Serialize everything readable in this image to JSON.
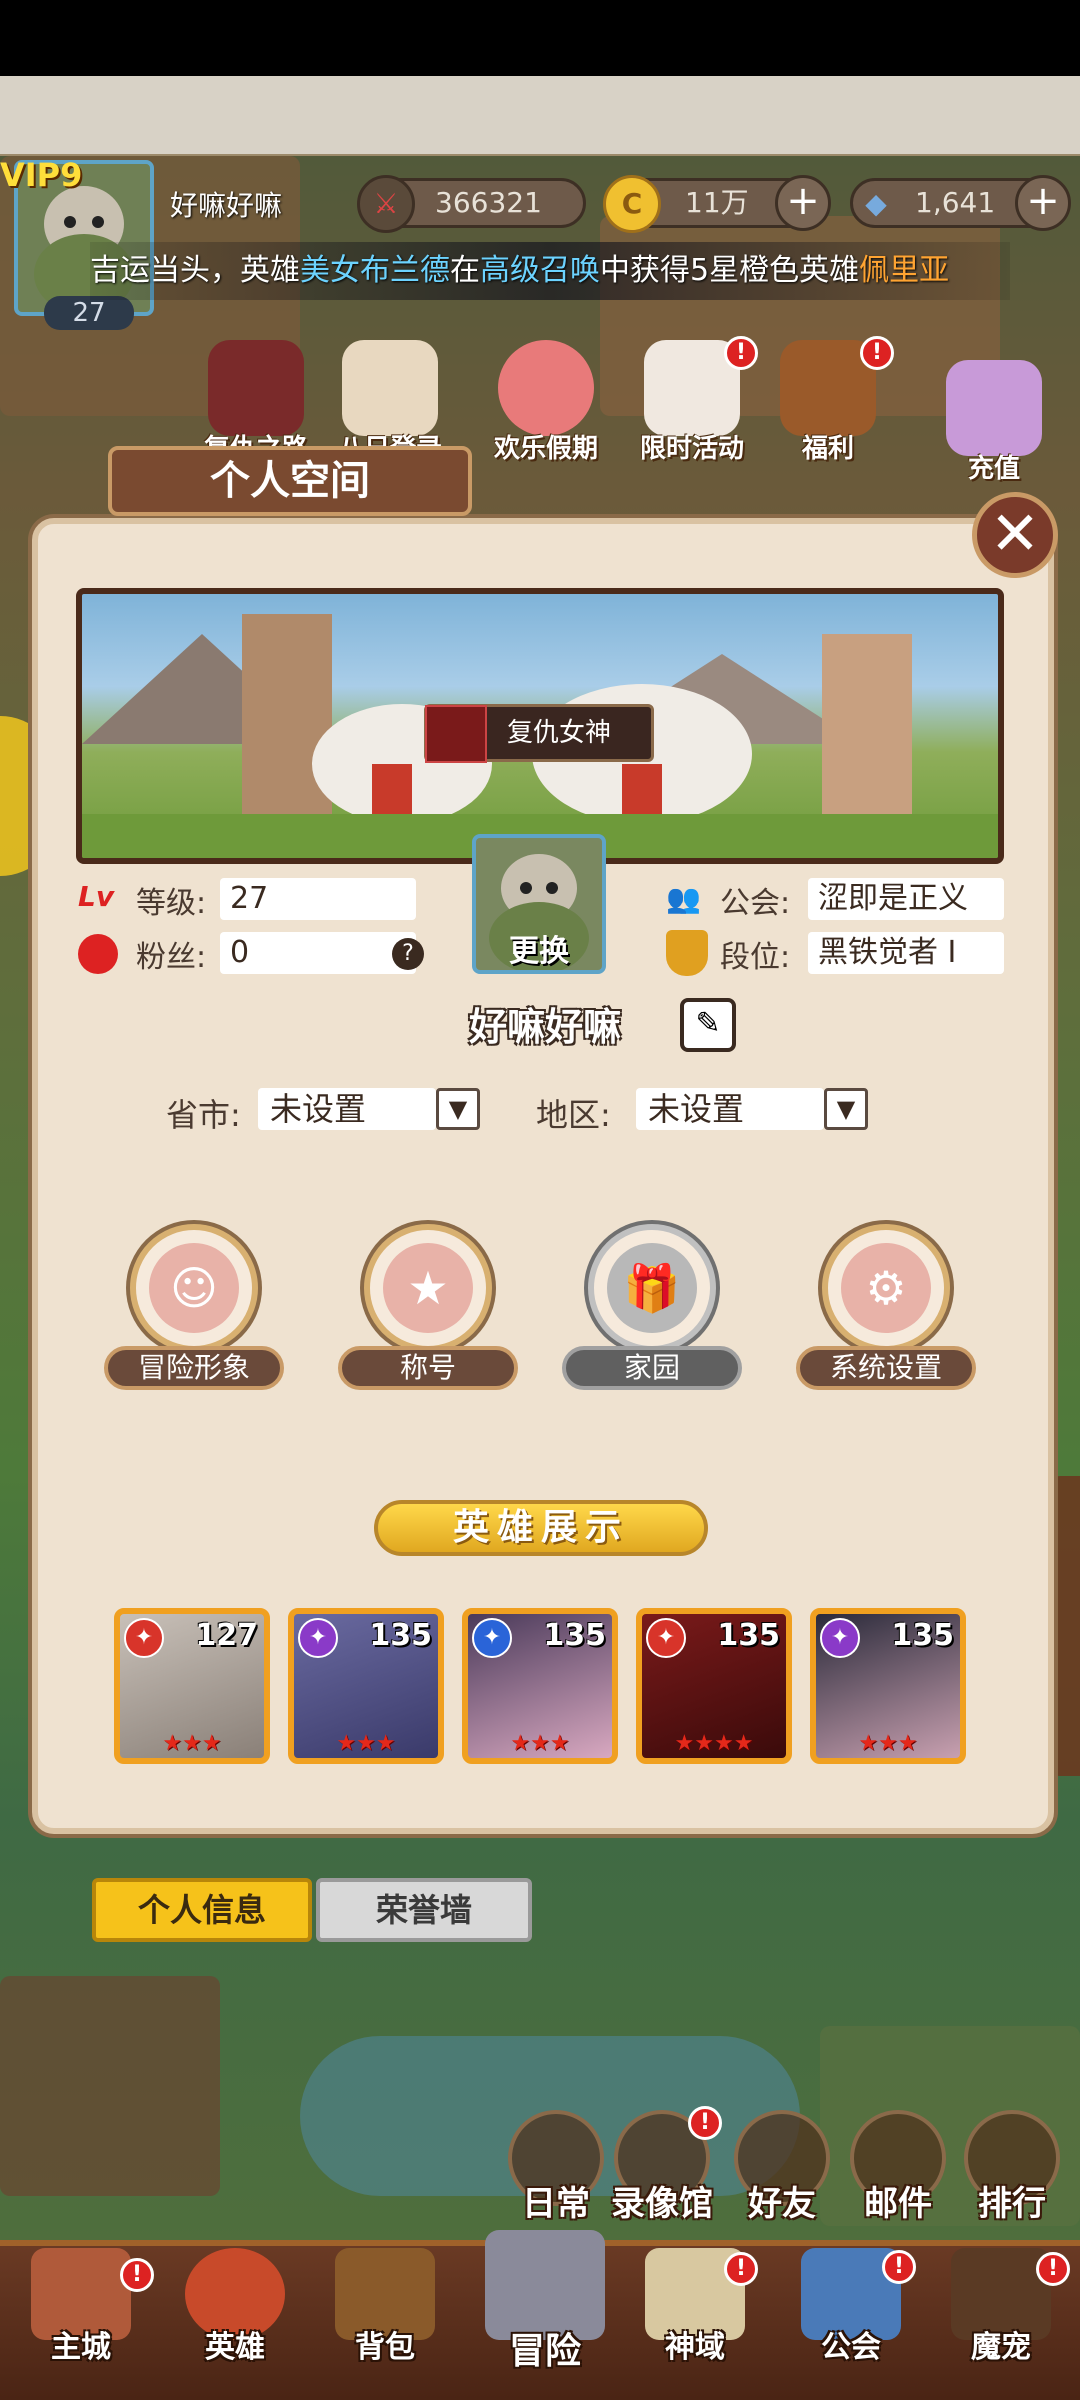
{
  "top_status": {
    "vip_level": "VIP9",
    "player_level": "27",
    "player_name": "好嘛好嘛",
    "power": "366321",
    "gold": "11万",
    "diamonds": "1,641"
  },
  "marquee": {
    "prefix": "吉运当头，英雄",
    "hero_name": "美女布兰德",
    "middle1": "在",
    "summon": "高级召唤",
    "middle2": "中获得5星橙色英雄",
    "reward": "佩里亚"
  },
  "activities": [
    {
      "label": "复仇之路",
      "icon": "sword-icon"
    },
    {
      "label": "八日登录",
      "icon": "calendar-icon"
    },
    {
      "label": "欢乐假期",
      "icon": "mascot-icon"
    },
    {
      "label": "限时活动",
      "icon": "cat-icon",
      "badge": "!"
    },
    {
      "label": "福利",
      "icon": "treasure-chest-icon",
      "badge": "!"
    },
    {
      "label": "充值",
      "icon": "gem-box-icon"
    }
  ],
  "dialog": {
    "title": "个人空间",
    "banner_title": "复仇女神",
    "level_label": "等级:",
    "level_value": "27",
    "fans_label": "粉丝:",
    "fans_value": "0",
    "guild_label": "公会:",
    "guild_value": "涩即是正义",
    "rank_label": "段位:",
    "rank_value": "黑铁觉者 I",
    "avatar_change": "更换",
    "player_name": "好嘛好嘛",
    "province_label": "省市:",
    "province_value": "未设置",
    "region_label": "地区:",
    "region_value": "未设置",
    "buttons": [
      {
        "label": "冒险形象",
        "icon": "silhouette-icon"
      },
      {
        "label": "称号",
        "icon": "star-badge-icon"
      },
      {
        "label": "家园",
        "icon": "gift-box-icon"
      },
      {
        "label": "系统设置",
        "icon": "gear-icon"
      }
    ],
    "hero_show_label": "英雄展示",
    "heroes": [
      {
        "level": "127",
        "element": "fire",
        "stars": 3
      },
      {
        "level": "135",
        "element": "dark",
        "stars": 3
      },
      {
        "level": "135",
        "element": "water",
        "stars": 3
      },
      {
        "level": "135",
        "element": "fire",
        "stars": 4
      },
      {
        "level": "135",
        "element": "dark",
        "stars": 3
      }
    ]
  },
  "tabs": [
    {
      "label": "个人信息",
      "active": true
    },
    {
      "label": "荣誉墙",
      "active": false
    }
  ],
  "quick_buttons": [
    {
      "label": "日常",
      "icon": "scroll-icon"
    },
    {
      "label": "录像馆",
      "icon": "film-icon",
      "badge": "!"
    },
    {
      "label": "好友",
      "icon": "friends-icon"
    },
    {
      "label": "邮件",
      "icon": "mail-icon"
    },
    {
      "label": "排行",
      "icon": "trophy-icon"
    }
  ],
  "nav": [
    {
      "label": "主城",
      "icon": "castle-icon",
      "badge": "!"
    },
    {
      "label": "英雄",
      "icon": "hero-medal-icon"
    },
    {
      "label": "背包",
      "icon": "backpack-icon"
    },
    {
      "label": "冒险",
      "icon": "crossed-swords-icon"
    },
    {
      "label": "神域",
      "icon": "map-scroll-icon",
      "badge": "!"
    },
    {
      "label": "公会",
      "icon": "guild-hall-icon",
      "badge": "!"
    },
    {
      "label": "魔宠",
      "icon": "pet-chest-icon",
      "badge": "!"
    }
  ],
  "colors": {
    "accent_blue": "#6cd3ff",
    "accent_orange": "#ffa432",
    "tab_active": "#f6c21a",
    "tab_inactive": "#d8d8d8",
    "badge_red": "#dd2222",
    "el_fire": "#d8342a",
    "el_dark": "#8a3ac8",
    "el_water": "#2a64d8"
  }
}
